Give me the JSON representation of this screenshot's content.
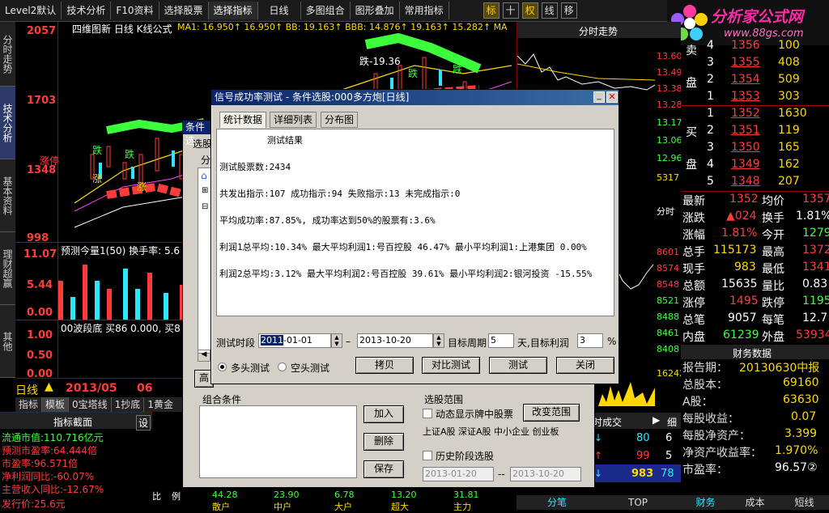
{
  "toolbar": {
    "items": [
      "Level2默认",
      "技术分析",
      "F10资料",
      "选择股票",
      "选择指标",
      "日线",
      "多图组合",
      "图形叠加",
      "常用指标"
    ],
    "icons": [
      "标",
      "十",
      "权",
      "线",
      "移"
    ]
  },
  "logo": {
    "text": "分析家公式网",
    "url": "www.88gs.com"
  },
  "leftnav": [
    "分时走势",
    "技术分析",
    "基本资料",
    "理财超赢",
    "其他"
  ],
  "chart": {
    "header": "四维图新 日线 K线公式",
    "ma1_label": "MA1: 16.950↑ 16.950↑ BB: 19.163↑ BBB: 14.876↑ 19.163↑ 15.282↑ MA",
    "y_labels": [
      "2057",
      "1703",
      "1348",
      "998"
    ],
    "sub_y_labels": [
      "11.07",
      "5.44",
      "0.00"
    ],
    "sub_header": "预测今量1(50)  换手率: 5.6",
    "sub3_y_labels": [
      "1.00",
      "0.50",
      "0.00"
    ],
    "sub3_header": "00波段底  买86  0.000, 买8",
    "date": "2013/05",
    "date2": "06",
    "day_label": "日线",
    "annotations": [
      "跌",
      "涨停",
      "跌",
      "涨",
      "跌-19.36",
      "跌",
      "涨",
      "跌"
    ],
    "tabs": [
      "指标",
      "模板",
      "0宝塔线",
      "1抄底",
      "1黄金"
    ]
  },
  "index_panel": {
    "title": "指标截面",
    "set": "设",
    "lines": [
      "流通市值:110.716亿元",
      "预测市盈率:64.444倍",
      "市盈率:96.571倍",
      "净利润同比:-60.07%",
      "主营收入同比:-12.67%",
      "发行价:25.6元"
    ]
  },
  "bottom_vals": {
    "labels": [
      "比",
      "例"
    ],
    "values": [
      "44.28",
      "23.90",
      "6.78",
      "13.20",
      "31.81"
    ],
    "names": [
      "散户",
      "中户",
      "大户",
      "超大",
      "主力"
    ]
  },
  "minute_chart": {
    "title": "分时走势",
    "prices": [
      "13.60",
      "13.49",
      "13.38",
      "13.28",
      "13.17",
      "13.06",
      "12.96"
    ],
    "vol": "5317",
    "time_label": "分时",
    "lower_vals": [
      "8601",
      "8574",
      "8548",
      "8521",
      "8488",
      "8461",
      "8408",
      "16242"
    ]
  },
  "order_book": {
    "sell": [
      {
        "n": "3",
        "price": "1355",
        "vol": "408"
      },
      {
        "n": "2",
        "price": "1354",
        "vol": "509"
      },
      {
        "n": "1",
        "price": "1353",
        "vol": "303"
      }
    ],
    "buy": [
      {
        "n": "1",
        "price": "1352",
        "vol": "1630"
      },
      {
        "n": "2",
        "price": "1351",
        "vol": "119"
      },
      {
        "n": "3",
        "price": "1350",
        "vol": "165"
      },
      {
        "n": "4",
        "price": "1349",
        "vol": "162"
      },
      {
        "n": "5",
        "price": "1348",
        "vol": "207"
      }
    ],
    "top_partial": {
      "n": "4",
      "price": "1356",
      "vol": "100"
    },
    "sell_label": "卖",
    "pan_label": "盘",
    "buy_label": "买"
  },
  "stats": [
    {
      "l1": "最新",
      "v1": "1352",
      "l2": "均价",
      "v2": "1357"
    },
    {
      "l1": "涨跌",
      "v1": "▲024",
      "l2": "换手",
      "v2": "1.81%"
    },
    {
      "l1": "涨幅",
      "v1": "1.81%",
      "l2": "今开",
      "v2": "1279"
    },
    {
      "l1": "总手",
      "v1": "115173",
      "l2": "最高",
      "v2": "1372"
    },
    {
      "l1": "现手",
      "v1": "983",
      "l2": "最低",
      "v2": "1341"
    },
    {
      "l1": "总额",
      "v1": "15635",
      "l2": "量比",
      "v2": "0.83"
    },
    {
      "l1": "涨停",
      "v1": "1495",
      "l2": "跌停",
      "v2": "1195"
    },
    {
      "l1": "总笔",
      "v1": "9057",
      "l2": "每笔",
      "v2": "12.7"
    },
    {
      "l1": "内盘",
      "v1": "61239",
      "l2": "外盘",
      "v2": "53934"
    }
  ],
  "finance": {
    "title": "财务数据",
    "rows": [
      {
        "k": "报告期：",
        "v": "20130630中报"
      },
      {
        "k": "总股本：",
        "v": "69160"
      },
      {
        "k": "A股：",
        "v": "63630"
      },
      {
        "k": "每股收益：",
        "v": "0.07"
      },
      {
        "k": "每股净资产：",
        "v": "3.399"
      },
      {
        "k": "净资产收益率：",
        "v": "1.970%"
      },
      {
        "k": "市盈率：",
        "v": "96.57②"
      }
    ],
    "tabs": [
      "财务",
      "成本",
      "短线"
    ]
  },
  "ticks": {
    "title": "时成交",
    "rows": [
      {
        "v1": "80",
        "v2": "6"
      },
      {
        "v1": "99",
        "v2": "5"
      },
      {
        "v1": "983",
        "v2": "78"
      }
    ],
    "tabs": [
      "分笔",
      "TOP"
    ],
    "fen": "细"
  },
  "behind_dialog": {
    "title": "条件选",
    "tab1": "选股",
    "tab2": "分",
    "btn": "高"
  },
  "dialog": {
    "title": "信号成功率测试 - 条件选股:000多方炮[日线]",
    "tabs": [
      "统计数据",
      "详细列表",
      "分布图"
    ],
    "result_title": "测试结果",
    "lines": [
      "测试股票数:2434",
      "共发出指示:107 成功指示:94 失败指示:13 未完成指示:0",
      "平均成功率:87.85%, 成功率达到50%的股票有:3.6%",
      "利润1总平均:10.34% 最大平均利润1:号百控股 46.47% 最小平均利润1:上港集团 0.00%",
      "利润2总平均:3.12% 最大平均利润2:号百控股 39.61% 最小平均利润2:银河投资 -15.55%"
    ],
    "period_label": "测试时段",
    "date_from_sel": "2011",
    "date_from_rest": "-01-01",
    "date_to": "2013-10-20",
    "target_period_label": "目标周期",
    "target_period": "5",
    "day_target_profit": "天,目标利润",
    "target_profit": "3",
    "pct": "%",
    "radio_long": "多头测试",
    "radio_short": "空头测试",
    "btn_copy": "拷贝",
    "btn_compare": "对比测试",
    "btn_test": "测试",
    "btn_close": "关闭"
  },
  "lower_dialog": {
    "combo_label": "组合条件",
    "btn_add": "加入",
    "btn_del": "删除",
    "btn_save": "保存",
    "range_label": "选股范围",
    "chk_dynamic": "动态显示牌中股票",
    "btn_change_range": "改变范围",
    "markets": "上证A股 深证A股 中小企业 创业板",
    "chk_history": "历史阶段选股",
    "hist_from": "2013-01-20",
    "hist_sep": "--",
    "hist_to": "2013-10-20"
  }
}
